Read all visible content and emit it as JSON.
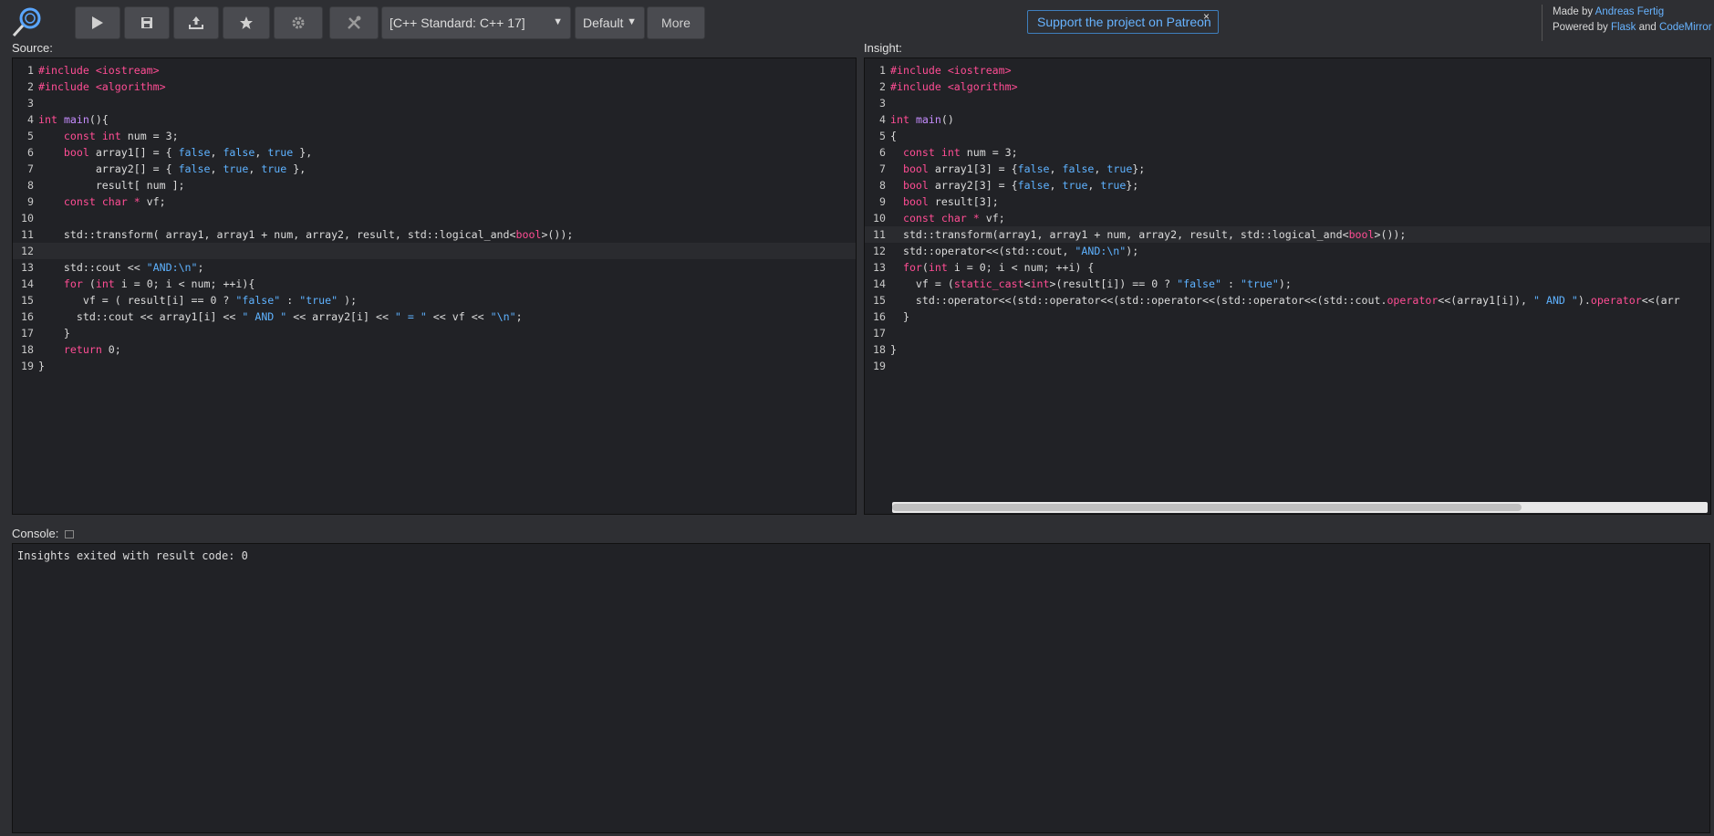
{
  "toolbar": {
    "standard_select": "[C++ Standard: C++ 17]",
    "default_select": "Default",
    "more_button": "More",
    "patreon_link": "Support the project on Patreon",
    "patreon_close": "×"
  },
  "credits": {
    "made_by_prefix": "Made by",
    "author": "Andreas Fertig",
    "powered_by_prefix": "Powered by",
    "flask": "Flask",
    "and": "and",
    "codemirror": "CodeMirror"
  },
  "labels": {
    "source": "Source:",
    "insight": "Insight:",
    "console": "Console:"
  },
  "console_output": "Insights exited with result code: 0",
  "colors": {
    "background": "#2e2f33",
    "editor_bg": "#212226",
    "keyword": "#ff4d94",
    "literal": "#5eb2ff",
    "function": "#c68dff",
    "link": "#67b3ff"
  },
  "icons": [
    "logo-magnifier-icon",
    "run-icon",
    "save-icon",
    "upload-icon",
    "star-icon",
    "settings-icon",
    "tools-icon"
  ]
}
